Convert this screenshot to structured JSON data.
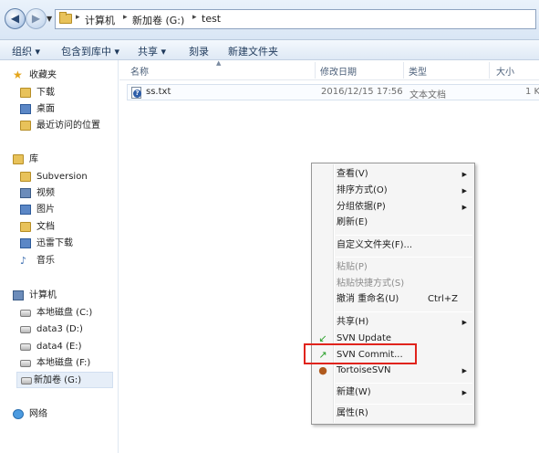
{
  "address": {
    "crumbs": [
      "计算机",
      "新加卷 (G:)",
      "test"
    ],
    "separator": "▸"
  },
  "toolbar": {
    "organize": "组织 ▾",
    "include_library": "包含到库中 ▾",
    "share": "共享 ▾",
    "burn": "刻录",
    "new_folder": "新建文件夹"
  },
  "nav": {
    "favorites": {
      "label": "收藏夹",
      "items": [
        "下载",
        "桌面",
        "最近访问的位置"
      ]
    },
    "libraries": {
      "label": "库",
      "items": [
        "Subversion",
        "视频",
        "图片",
        "文档",
        "迅雷下载",
        "音乐"
      ]
    },
    "computer": {
      "label": "计算机",
      "items": [
        "本地磁盘 (C:)",
        "data3 (D:)",
        "data4 (E:)",
        "本地磁盘 (F:)",
        "新加卷 (G:)"
      ]
    },
    "network": {
      "label": "网络"
    }
  },
  "columns": {
    "name": "名称",
    "modified": "修改日期",
    "type": "类型",
    "size": "大小"
  },
  "file": {
    "name": "ss.txt",
    "modified": "2016/12/15 17:56",
    "type": "文本文档",
    "size": "1 K"
  },
  "menu": {
    "view": "查看(V)",
    "sort": "排序方式(O)",
    "group": "分组依据(P)",
    "refresh": "刷新(E)",
    "customize": "自定义文件夹(F)...",
    "paste": "粘贴(P)",
    "paste_shortcut": "粘贴快捷方式(S)",
    "undo_rename": "撤消 重命名(U)",
    "undo_shortcut": "Ctrl+Z",
    "share": "共享(H)",
    "svn_update": "SVN Update",
    "svn_commit": "SVN Commit...",
    "tortoise": "TortoiseSVN",
    "new": "新建(W)",
    "properties": "属性(R)"
  },
  "colors": {
    "highlight_box": "#e0231c",
    "svn_green": "#2aa12a"
  }
}
